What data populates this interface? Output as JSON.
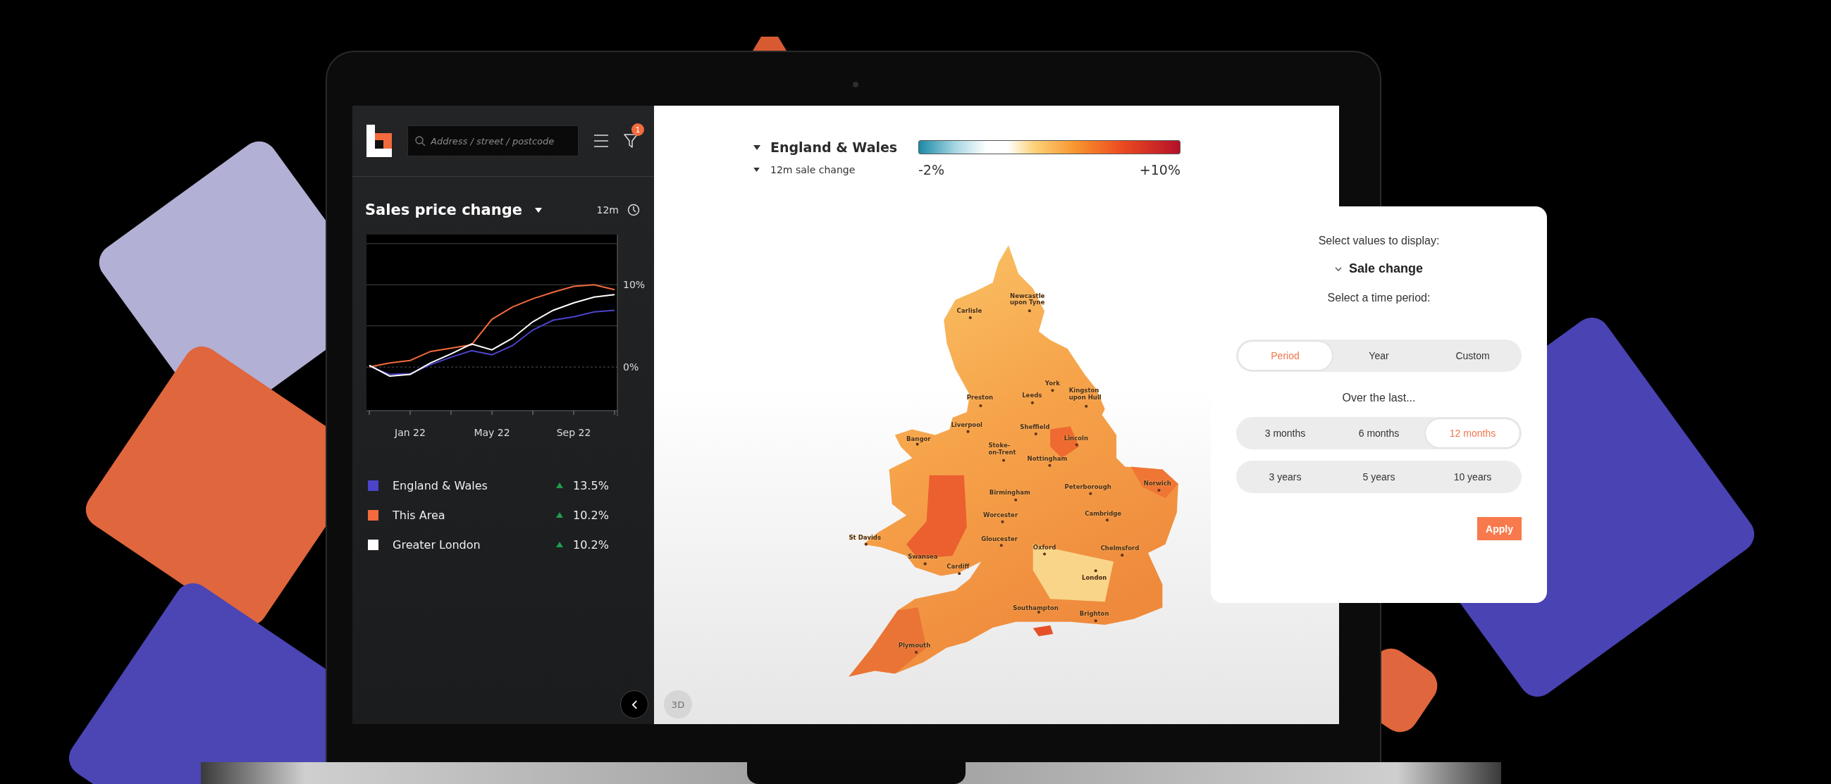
{
  "sidebar": {
    "search": {
      "placeholder": "Address / street / postcode"
    },
    "filter_badge": "1",
    "title": "Sales price change",
    "period": "12m",
    "chart_data": {
      "type": "line",
      "categories": [
        null,
        null,
        "Jan 22",
        null,
        null,
        null,
        "May 22",
        null,
        null,
        null,
        "Sep 22",
        null,
        null
      ],
      "ref_lines": [
        {
          "axis": "y",
          "value": 0
        }
      ],
      "series": [
        {
          "color": "#4b44c9",
          "values": [
            0.1,
            -0.9,
            -0.8,
            0.3,
            1.2,
            2.0,
            1.5,
            2.6,
            4.5,
            5.7,
            6.1,
            6.7,
            6.9
          ]
        },
        {
          "color": "#f26a3d",
          "values": [
            0.0,
            0.5,
            0.8,
            1.9,
            2.3,
            2.7,
            5.8,
            7.3,
            8.3,
            9.1,
            9.8,
            10.0,
            9.4
          ]
        },
        {
          "color": "#ffffff",
          "values": [
            0.2,
            -1.1,
            -0.9,
            0.5,
            1.6,
            2.8,
            2.1,
            3.5,
            5.5,
            6.9,
            7.8,
            8.5,
            8.8
          ]
        }
      ],
      "yticks": [
        {
          "value": 0,
          "label": "0%"
        },
        {
          "value": 10,
          "label": "10%"
        }
      ],
      "ylim": [
        -5.3,
        16.1
      ]
    },
    "legend": [
      {
        "name": "England & Wales",
        "color": "#4b44c9",
        "change": "13.5%"
      },
      {
        "name": "This Area",
        "color": "#f26a3d",
        "change": "10.2%"
      },
      {
        "name": "Greater London",
        "color": "#ffffff",
        "change": "10.2%"
      }
    ]
  },
  "map": {
    "region": "England & Wales",
    "measure": "12m sale change",
    "scale": {
      "min_label": "-2%",
      "max_label": "+10%"
    },
    "cities": [
      "Carlisle",
      "Newcastle upon Tyne",
      "York",
      "Preston",
      "Leeds",
      "Kingston upon Hull",
      "Liverpool",
      "Sheffield",
      "Bangor",
      "Lincoln",
      "Stoke-on-Trent",
      "Nottingham",
      "Birmingham",
      "Peterborough",
      "Norwich",
      "Worcester",
      "Cambridge",
      "St Davids",
      "Gloucester",
      "Oxford",
      "Chelmsford",
      "Swansea",
      "Cardiff",
      "London",
      "Southampton",
      "Brighton",
      "Plymouth"
    ],
    "view_3d": {
      "label": "3D",
      "disabled": true
    }
  },
  "popup": {
    "heading": "Select values to display:",
    "value": "Sale change",
    "period_heading": "Select a time period:",
    "period_tabs": [
      {
        "label": "Period",
        "selected": true
      },
      {
        "label": "Year",
        "selected": false
      },
      {
        "label": "Custom",
        "selected": false
      }
    ],
    "range_heading": "Over the last...",
    "range_rows": [
      {
        "options": [
          {
            "label": "3 months",
            "selected": false
          },
          {
            "label": "6 months",
            "selected": false
          },
          {
            "label": "12 months",
            "selected": true
          }
        ]
      },
      {
        "options": [
          {
            "label": "3 years",
            "selected": false
          },
          {
            "label": "5 years",
            "selected": false
          },
          {
            "label": "10 years",
            "selected": false
          }
        ]
      }
    ],
    "apply": "Apply"
  }
}
